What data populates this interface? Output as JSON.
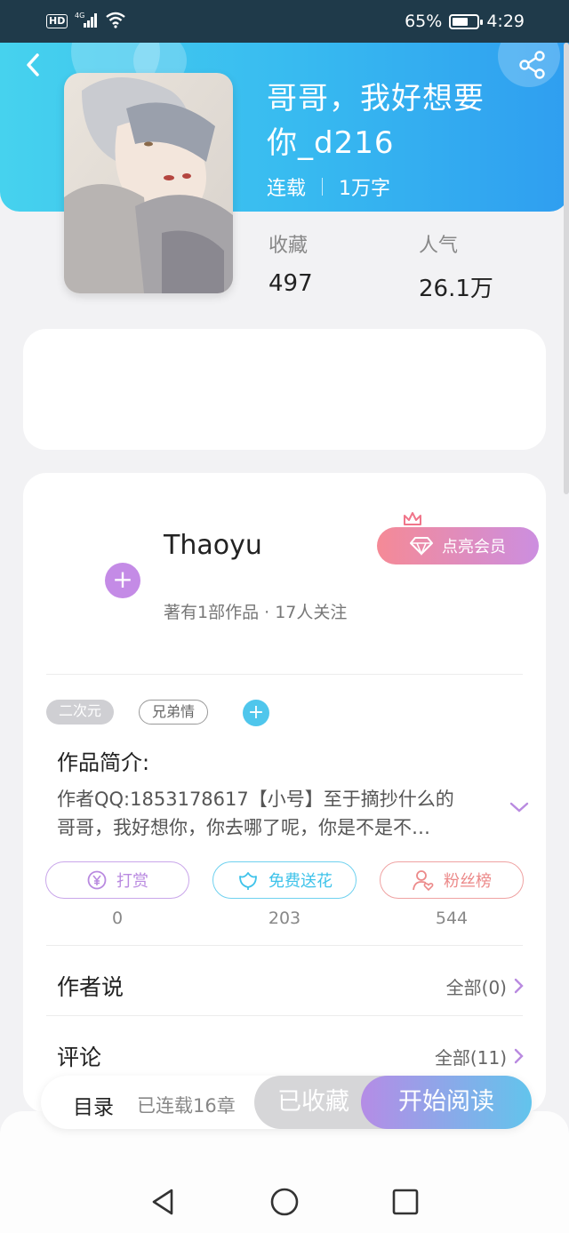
{
  "status_bar": {
    "network": "4G",
    "battery_text": "65%",
    "battery_level": 0.65,
    "time": "4:29",
    "hd": "HD"
  },
  "book": {
    "title_line1": "哥哥，我好想要",
    "title_line2": "你_d216",
    "status": "连载",
    "word_count": "1万字",
    "stats": [
      {
        "label": "收藏",
        "value": "497"
      },
      {
        "label": "人气",
        "value": "26.1万"
      }
    ]
  },
  "author": {
    "name": "Thaoyu",
    "info": "著有1部作品 · 17人关注",
    "vip_label": "点亮会员"
  },
  "tags": [
    "二次元",
    "兄弟情"
  ],
  "intro": {
    "title": "作品简介:",
    "line1": "作者QQ:1853178617【小号】至于摘抄什么的",
    "line2": "哥哥，我好想你，你去哪了呢，你是不是不…"
  },
  "actions": [
    {
      "label": "打赏",
      "count": "0",
      "color": "#b98ae0"
    },
    {
      "label": "免费送花",
      "count": "203",
      "color": "#3fc3ea"
    },
    {
      "label": "粉丝榜",
      "count": "544",
      "color": "#ec8a8a"
    }
  ],
  "sections": [
    {
      "title": "作者说",
      "link": "全部(0)"
    },
    {
      "title": "评论",
      "link": "全部(11)"
    }
  ],
  "bottom": {
    "toc": "目录",
    "serial_count": "已连载16章",
    "favorited": "已收藏",
    "start_reading": "开始阅读"
  }
}
